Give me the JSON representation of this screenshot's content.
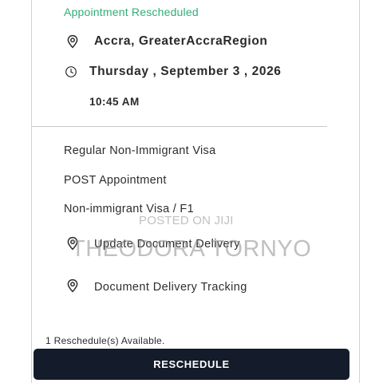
{
  "appointment": {
    "status": "Appointment Rescheduled",
    "location": "Accra, GreaterAccraRegion",
    "date": "Thursday , September 3 , 2026",
    "time": "10:45 AM"
  },
  "details": {
    "visa_category": "Regular Non-Immigrant Visa",
    "appointment_type": "POST Appointment",
    "visa_class": "Non-immigrant Visa / F1"
  },
  "actions": {
    "update_delivery": "Update Document Delivery",
    "delivery_tracking": "Document Delivery Tracking"
  },
  "watermark": {
    "line1": "POSTED ON JIJI",
    "line2": "THEODORA TORNYO"
  },
  "reschedule": {
    "available_text": "1 Reschedule(s) Available.",
    "button_label": "RESCHEDULE"
  },
  "colors": {
    "status_green": "#2fae78",
    "button_navy": "#141c2b"
  }
}
